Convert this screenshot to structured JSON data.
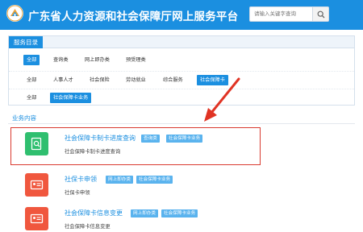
{
  "header": {
    "title": "广东省人力资源和社会保障厅网上服务平台",
    "search_placeholder": "请输入关键字查询",
    "search_icon": "search-icon",
    "bg_color": "#1b8fe0"
  },
  "catalog": {
    "title": "服务目录",
    "row1": [
      "全部",
      "查询类",
      "网上即办类",
      "预受理类"
    ],
    "row2": [
      "全部",
      "人事人才",
      "社会保险",
      "劳动就业",
      "综合服务",
      "社会保障卡"
    ],
    "row3": [
      "全部",
      "社会保障卡业务"
    ]
  },
  "section": {
    "title": "业务内容"
  },
  "items": [
    {
      "title": "社会保障卡制卡进度查询",
      "tags": [
        "查询类",
        "社会保障卡业务"
      ],
      "desc": "社会保障卡制卡进度查询",
      "icon": "search-document-icon",
      "color": "#2fbf6f"
    },
    {
      "title": "社保卡申领",
      "tags": [
        "网上即办类",
        "社会保障卡业务"
      ],
      "desc": "社保卡申领",
      "icon": "id-card-icon",
      "color": "#f0573e"
    },
    {
      "title": "社会保障卡信息变更",
      "tags": [
        "网上即办类",
        "社会保障卡业务"
      ],
      "desc": "社会保障卡信息变更",
      "icon": "id-card-icon",
      "color": "#f0573e"
    }
  ],
  "annotation_color": "#d93a2f"
}
